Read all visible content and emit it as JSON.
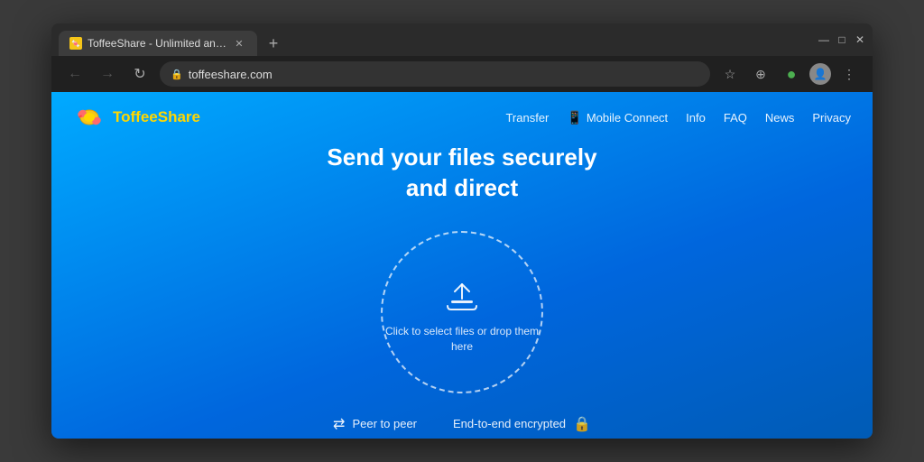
{
  "browser": {
    "tab": {
      "title": "ToffeeShare - Unlimited and sec...",
      "favicon": "🍬"
    },
    "new_tab_label": "+",
    "window_controls": {
      "minimize": "—",
      "maximize": "□",
      "close": "✕"
    },
    "address_bar": {
      "url": "toffeeshare.com",
      "lock_symbol": "🔒"
    },
    "toolbar": {
      "extensions_icon": "⊕",
      "profile_icon": "●",
      "menu_icon": "⋮"
    }
  },
  "site": {
    "logo_text_part1": "Toffee",
    "logo_text_part2": "Share",
    "nav": {
      "transfer": "Transfer",
      "mobile_connect": "Mobile Connect",
      "info": "Info",
      "faq": "FAQ",
      "news": "News",
      "privacy": "Privacy"
    },
    "hero": {
      "title_line1": "Send your files securely",
      "title_line2": "and direct"
    },
    "drop_zone": {
      "text": "Click to select files or drop them here"
    },
    "features": [
      {
        "icon": "⇄",
        "label": "Peer to peer"
      },
      {
        "icon": "🔒",
        "label": "End-to-end encrypted"
      }
    ]
  }
}
